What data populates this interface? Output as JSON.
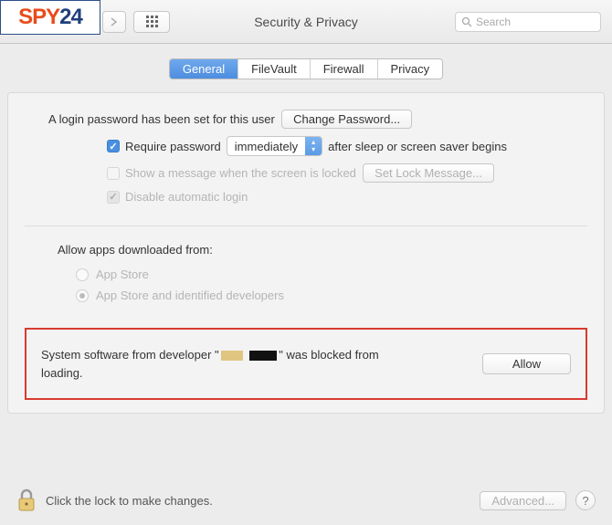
{
  "watermark_logo": "SPY24",
  "toolbar": {
    "title": "Security & Privacy",
    "search_placeholder": "Search"
  },
  "tabs": [
    {
      "label": "General",
      "active": true
    },
    {
      "label": "FileVault",
      "active": false
    },
    {
      "label": "Firewall",
      "active": false
    },
    {
      "label": "Privacy",
      "active": false
    }
  ],
  "login": {
    "password_set_text": "A login password has been set for this user",
    "change_password_btn": "Change Password...",
    "require_password_label": "Require password",
    "require_password_select": "immediately",
    "after_sleep_text": "after sleep or screen saver begins",
    "show_message_label": "Show a message when the screen is locked",
    "set_lock_message_btn": "Set Lock Message...",
    "disable_auto_login_label": "Disable automatic login"
  },
  "download": {
    "section_title": "Allow apps downloaded from:",
    "option_app_store": "App Store",
    "option_identified": "App Store and identified developers"
  },
  "blocked": {
    "text_prefix": "System software from developer \"",
    "text_suffix": "\" was blocked from loading.",
    "allow_btn": "Allow"
  },
  "footer": {
    "lock_text": "Click the lock to make changes.",
    "advanced_btn": "Advanced...",
    "help": "?"
  }
}
